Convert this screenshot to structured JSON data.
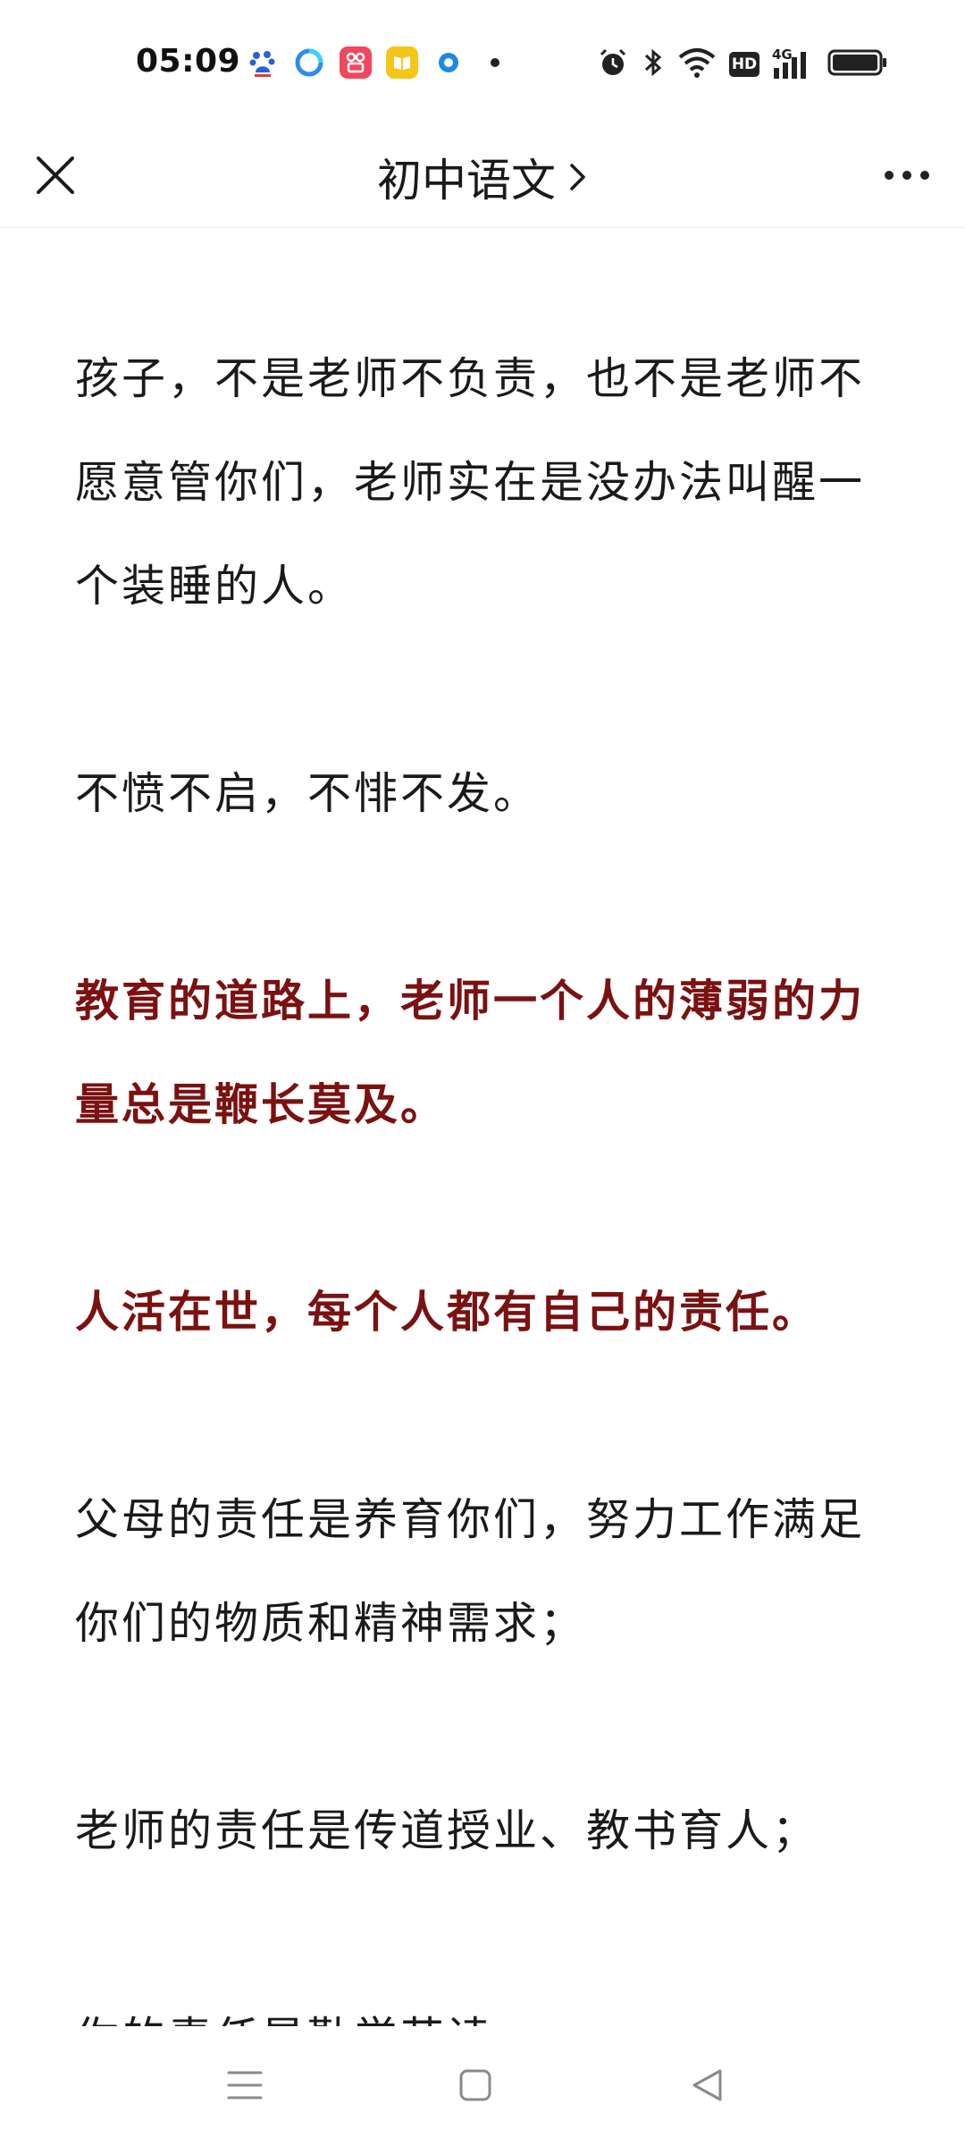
{
  "status_bar": {
    "time": "05:09",
    "notification_icons": [
      "baidu-icon",
      "browser-icon",
      "video-app-icon",
      "reader-app-icon",
      "app-ring-icon",
      "more-dot-icon"
    ],
    "system_icons": [
      "alarm-icon",
      "bluetooth-icon",
      "wifi-icon",
      "hd-icon",
      "signal-4g-icon",
      "battery-icon"
    ],
    "hd_label": "HD",
    "network_label": "4G"
  },
  "nav": {
    "title": "初中语文",
    "chevron": "›"
  },
  "article": {
    "paragraphs": [
      {
        "text": "孩子，不是老师不负责，也不是老师不愿意管你们，老师实在是没办法叫醒一个装睡的人。",
        "emphasis": false
      },
      {
        "text": "不愤不启，不悱不发。",
        "emphasis": false
      },
      {
        "text": "教育的道路上，老师一个人的薄弱的力量总是鞭长莫及。",
        "emphasis": true
      },
      {
        "text": "人活在世，每个人都有自己的责任。",
        "emphasis": true
      },
      {
        "text": "父母的责任是养育你们，努力工作满足你们的物质和精神需求；",
        "emphasis": false
      },
      {
        "text": "老师的责任是传道授业、教书育人；",
        "emphasis": false
      },
      {
        "text": "你的责任是勤学苦读",
        "emphasis": false
      }
    ]
  },
  "colors": {
    "emphasis_text": "#7b1111",
    "body_text": "#1a1a1a",
    "background": "#ffffff"
  }
}
